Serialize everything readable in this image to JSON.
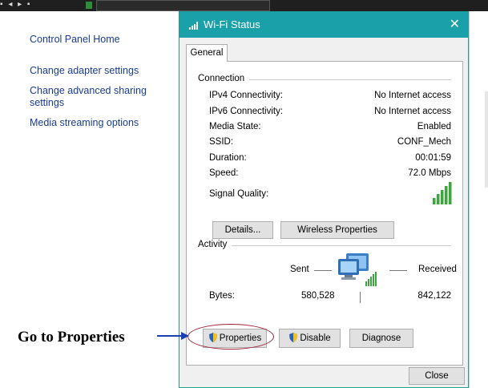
{
  "left_panel": {
    "home": "Control Panel Home",
    "links": [
      "Change adapter settings",
      "Change advanced sharing",
      "settings",
      "Media streaming options"
    ]
  },
  "dialog": {
    "title": "Wi-Fi Status",
    "close": "✕",
    "tab": "General",
    "connection": {
      "label": "Connection",
      "rows": [
        {
          "label": "IPv4 Connectivity:",
          "value": "No Internet access"
        },
        {
          "label": "IPv6 Connectivity:",
          "value": "No Internet access"
        },
        {
          "label": "Media State:",
          "value": "Enabled"
        },
        {
          "label": "SSID:",
          "value": "CONF_Mech"
        },
        {
          "label": "Duration:",
          "value": "00:01:59"
        },
        {
          "label": "Speed:",
          "value": "72.0 Mbps"
        }
      ],
      "signal_label": "Signal Quality:",
      "signal_bars": 5,
      "signal_total": 5
    },
    "buttons": {
      "details": "Details...",
      "wireless": "Wireless Properties"
    },
    "activity": {
      "label": "Activity",
      "sent": "Sent",
      "received": "Received",
      "bytes_label": "Bytes:",
      "bytes_sent": "580,528",
      "bytes_received": "842,122"
    },
    "actions": {
      "properties": "Properties",
      "disable": "Disable",
      "diagnose": "Diagnose",
      "close": "Close"
    }
  },
  "annotation": {
    "text": "Go to Properties"
  },
  "colors": {
    "titlebar": "#1aa0a8",
    "link": "#1a3b8f",
    "signal": "#3aa83a",
    "highlight": "#a0233a"
  }
}
